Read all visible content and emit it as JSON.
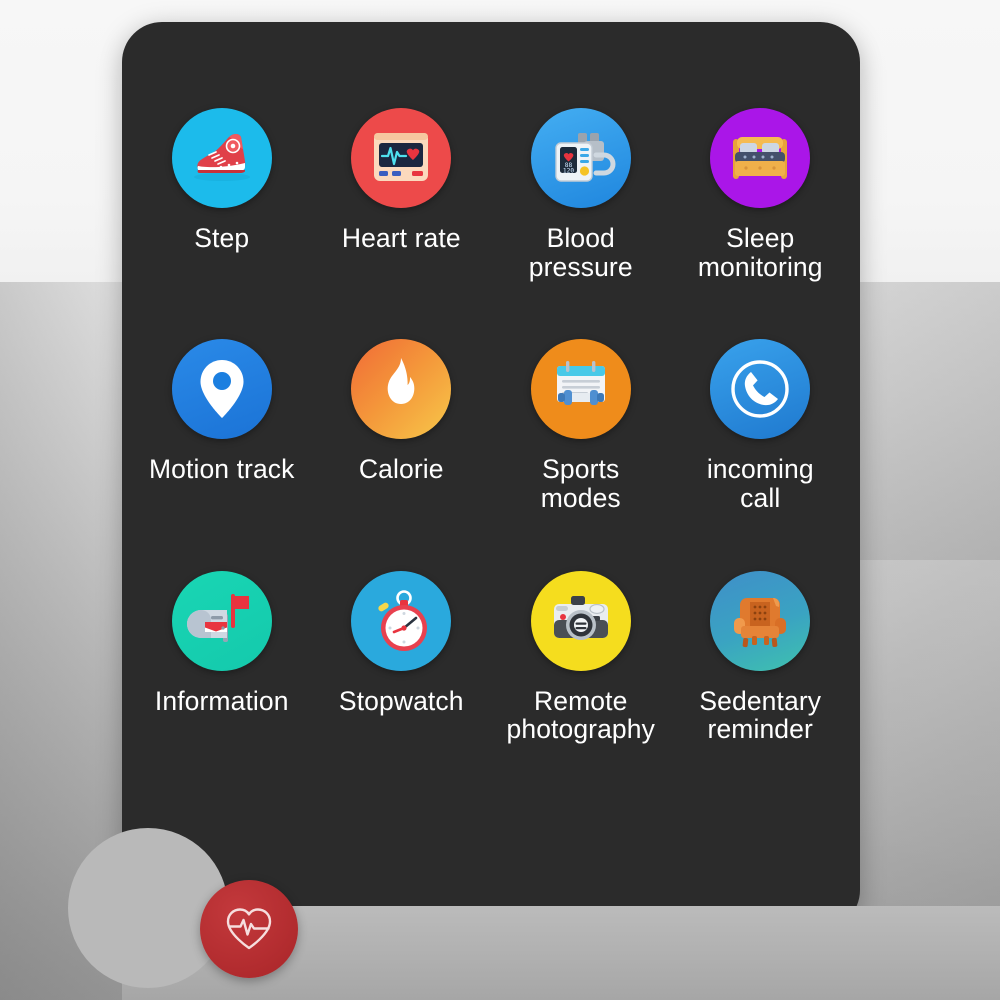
{
  "app": {
    "card_background": "#2b2b2b",
    "label_color": "#ffffff"
  },
  "grid": {
    "items": [
      {
        "label": "Step",
        "icon": "sneaker-icon",
        "bg": "#1cbbeb"
      },
      {
        "label": "Heart rate",
        "icon": "heart-monitor-icon",
        "bg": "#ed4a4a"
      },
      {
        "label": "Blood\npressure",
        "icon": "blood-pressure-icon",
        "bg": "#2e9fea",
        "display": "88\n120"
      },
      {
        "label": "Sleep\nmonitoring",
        "icon": "bed-icon",
        "bg": "#aa16e8"
      },
      {
        "label": "Motion track",
        "icon": "map-pin-icon",
        "bg": "#1b7fe0"
      },
      {
        "label": "Calorie",
        "icon": "flame-icon",
        "bg": "#f4a93c"
      },
      {
        "label": "Sports\nmodes",
        "icon": "dumbbell-notes-icon",
        "bg": "#ef8c1b"
      },
      {
        "label": "incoming\ncall",
        "icon": "phone-handset-icon",
        "bg": "#2b8fe0"
      },
      {
        "label": "Information",
        "icon": "mailbox-icon",
        "bg": "#1ad0b0"
      },
      {
        "label": "Stopwatch",
        "icon": "stopwatch-icon",
        "bg": "#2aa9dd"
      },
      {
        "label": "Remote\nphotography",
        "icon": "camera-icon",
        "bg": "#f5dd1e"
      },
      {
        "label": "Sedentary\nreminder",
        "icon": "armchair-icon",
        "bg": "#3aa0c8"
      }
    ]
  },
  "fab": {
    "icon": "heart-pulse-icon",
    "color": "#b52e31"
  }
}
